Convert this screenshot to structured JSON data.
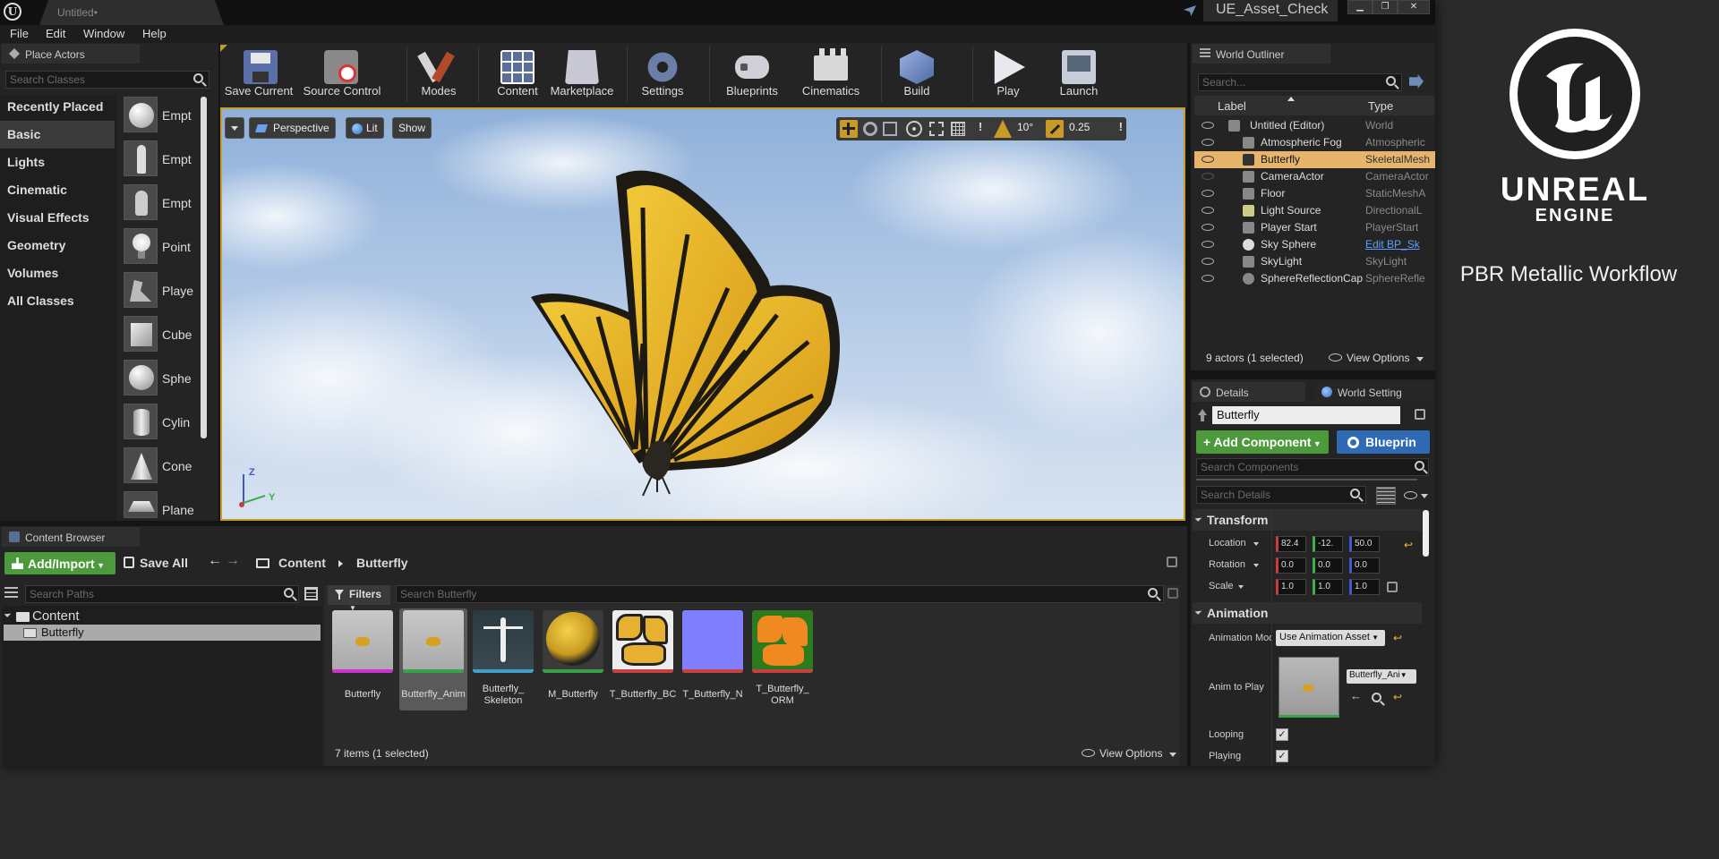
{
  "window": {
    "doc_tab": "Untitled•",
    "project_name": "UE_Asset_Check",
    "min": "▁",
    "max": "❐",
    "close": "✕"
  },
  "menu": [
    "File",
    "Edit",
    "Window",
    "Help"
  ],
  "place_actors": {
    "tab": "Place Actors",
    "search_placeholder": "Search Classes",
    "categories": [
      "Recently Placed",
      "Basic",
      "Lights",
      "Cinematic",
      "Visual Effects",
      "Geometry",
      "Volumes",
      "All Classes"
    ],
    "selected_category": "Basic",
    "items": [
      "Empt",
      "Empt",
      "Empt",
      "Point",
      "Playe",
      "Cube",
      "Sphe",
      "Cylin",
      "Cone",
      "Plane"
    ]
  },
  "toolbar": [
    {
      "label": "Save Current",
      "icon": "save-icon"
    },
    {
      "label": "Source Control",
      "icon": "source-control-icon"
    },
    {
      "label": "Modes",
      "icon": "modes-icon"
    },
    {
      "label": "Content",
      "icon": "content-icon"
    },
    {
      "label": "Marketplace",
      "icon": "marketplace-icon"
    },
    {
      "label": "Settings",
      "icon": "settings-icon"
    },
    {
      "label": "Blueprints",
      "icon": "blueprints-icon"
    },
    {
      "label": "Cinematics",
      "icon": "cinematics-icon"
    },
    {
      "label": "Build",
      "icon": "build-icon"
    },
    {
      "label": "Play",
      "icon": "play-icon"
    },
    {
      "label": "Launch",
      "icon": "launch-icon"
    }
  ],
  "viewport": {
    "perspective": "Perspective",
    "lit": "Lit",
    "show": "Show",
    "angle_snap": "10°",
    "scale_snap": "0.25",
    "axis_z": "Z",
    "axis_y": "Y"
  },
  "outliner": {
    "tab": "World Outliner",
    "search_placeholder": "Search...",
    "col_label": "Label",
    "col_type": "Type",
    "rows": [
      {
        "name": "Untitled (Editor)",
        "type": "World"
      },
      {
        "name": "Atmospheric Fog",
        "type": "Atmospheric"
      },
      {
        "name": "Butterfly",
        "type": "SkeletalMesh"
      },
      {
        "name": "CameraActor",
        "type": "CameraActor"
      },
      {
        "name": "Floor",
        "type": "StaticMeshA"
      },
      {
        "name": "Light Source",
        "type": "DirectionalL"
      },
      {
        "name": "Player Start",
        "type": "PlayerStart"
      },
      {
        "name": "Sky Sphere",
        "type": "Edit BP_Sk"
      },
      {
        "name": "SkyLight",
        "type": "SkyLight"
      },
      {
        "name": "SphereReflectionCap",
        "type": "SphereRefle"
      }
    ],
    "selected_index": 2,
    "status": "9 actors (1 selected)",
    "view_options": "View Options"
  },
  "details": {
    "tab_details": "Details",
    "tab_world": "World Setting",
    "object_name": "Butterfly",
    "add_component": "Add Component",
    "blueprint": "Blueprin",
    "search_components": "Search Components",
    "search_details": "Search Details",
    "transform_header": "Transform",
    "location_label": "Location",
    "rotation_label": "Rotation",
    "scale_label": "Scale",
    "location": [
      "82.4",
      "-12.",
      "50.0"
    ],
    "rotation": [
      "0.0",
      "0.0",
      "0.0"
    ],
    "scale": [
      "1.0",
      "1.0",
      "1.0"
    ],
    "animation_header": "Animation",
    "animation_mode_label": "Animation Mod",
    "animation_mode_value": "Use Animation Asset",
    "anim_to_play_label": "Anim to Play",
    "anim_to_play_value": "Butterfly_Ani",
    "looping_label": "Looping",
    "playing_label": "Playing"
  },
  "content_browser": {
    "tab": "Content Browser",
    "add_import": "Add/Import",
    "save_all": "Save All",
    "path_root": "Content",
    "path_folder": "Butterfly",
    "search_paths": "Search Paths",
    "filters": "Filters",
    "search_assets": "Search Butterfly",
    "tree_root": "Content",
    "tree_child": "Butterfly",
    "assets": [
      {
        "name": "Butterfly",
        "bar": "#d030d0"
      },
      {
        "name": "Butterfly_Anim",
        "bar": "#3aa04a"
      },
      {
        "name": "Butterfly_\nSkeleton",
        "bar": "#40a0c8"
      },
      {
        "name": "M_Butterfly",
        "bar": "#3aa04a"
      },
      {
        "name": "T_Butterfly_BC",
        "bar": "#c84040"
      },
      {
        "name": "T_Butterfly_N",
        "bar": "#c84040"
      },
      {
        "name": "T_Butterfly_\nORM",
        "bar": "#c84040"
      }
    ],
    "selected_asset": 1,
    "status": "7 items (1 selected)",
    "view_options": "View Options"
  },
  "branding": {
    "line1": "UNREAL",
    "line2": "ENGINE",
    "subtitle": "PBR Metallic Workflow"
  }
}
